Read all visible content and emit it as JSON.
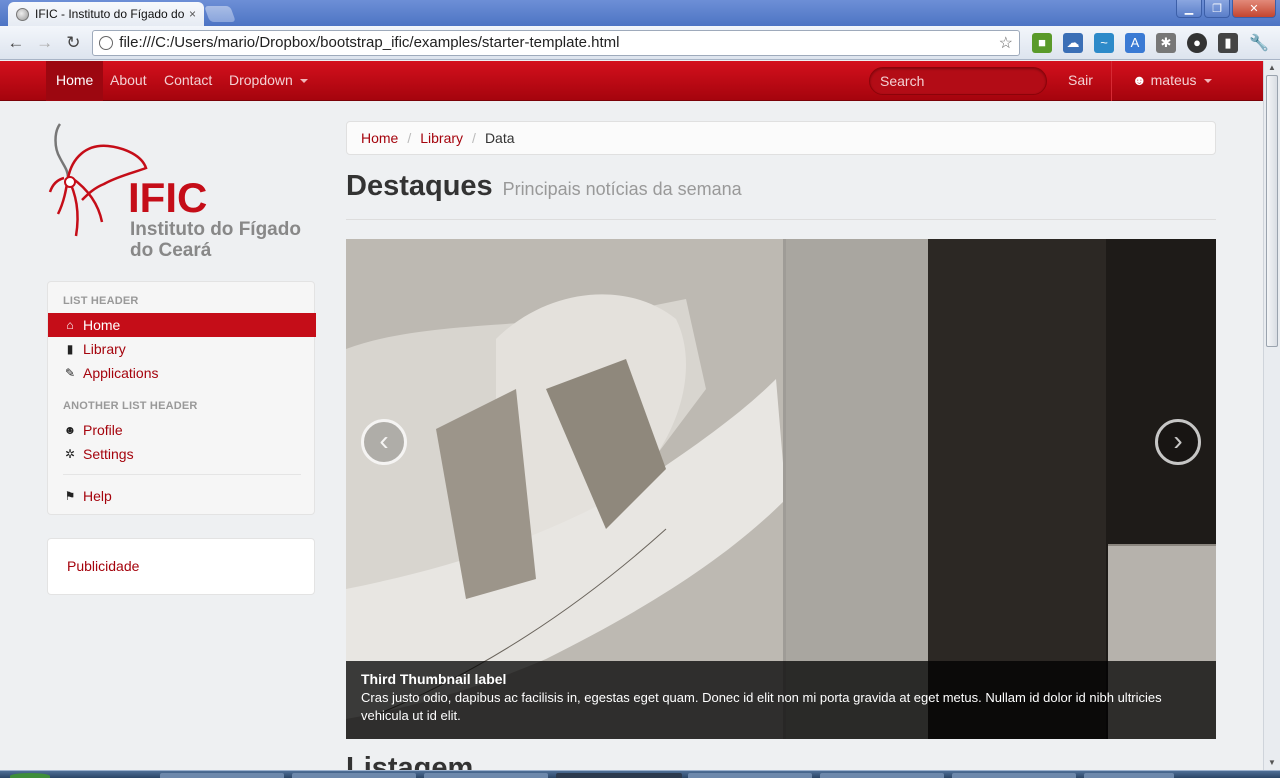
{
  "browser": {
    "tab_title": "IFIC - Instituto do Fígado do",
    "tab_close": "×",
    "url": "file:///C:/Users/mario/Dropbox/bootstrap_ific/examples/starter-template.html"
  },
  "navbar": {
    "items": [
      {
        "label": "Home"
      },
      {
        "label": "About"
      },
      {
        "label": "Contact"
      },
      {
        "label": "Dropdown"
      }
    ],
    "search_placeholder": "Search",
    "logout_label": "Sair",
    "user_label": "mateus"
  },
  "logo": {
    "brand": "IFIC",
    "line1": "Instituto do Fígado",
    "line2": "do Ceará"
  },
  "sidebar": {
    "header1": "LIST HEADER",
    "header2": "ANOTHER LIST HEADER",
    "items": [
      {
        "label": "Home",
        "icon": "home-icon"
      },
      {
        "label": "Library",
        "icon": "book-icon"
      },
      {
        "label": "Applications",
        "icon": "pencil-icon"
      },
      {
        "label": "Profile",
        "icon": "user-icon"
      },
      {
        "label": "Settings",
        "icon": "cog-icon"
      },
      {
        "label": "Help",
        "icon": "flag-icon"
      }
    ],
    "ad_label": "Publicidade"
  },
  "breadcrumb": {
    "items": [
      "Home",
      "Library",
      "Data"
    ],
    "separator": "/"
  },
  "page_header": {
    "title": "Destaques",
    "subtitle": "Principais notícias da semana"
  },
  "carousel": {
    "prev": "‹",
    "next": "›",
    "caption_title": "Third Thumbnail label",
    "caption_text": "Cras justo odio, dapibus ac facilisis in, egestas eget quam. Donec id elit non mi porta gravida at eget metus. Nullam id dolor id nibh ultricies vehicula ut id elit."
  },
  "section_title": "Listagem",
  "colors": {
    "brand_red": "#c50d18",
    "link_red": "#a5040d"
  }
}
